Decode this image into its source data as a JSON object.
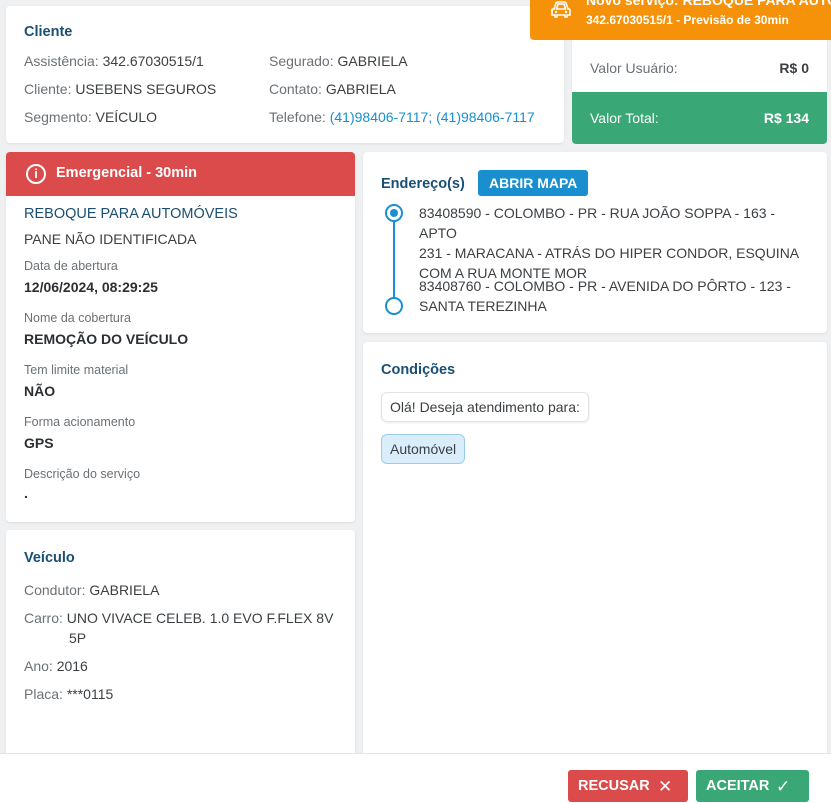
{
  "cliente": {
    "title": "Cliente",
    "assistencia_label": "Assistência:",
    "assistencia_value": "342.67030515/1",
    "cliente_label": "Cliente:",
    "cliente_value": "USEBENS SEGUROS",
    "segmento_label": "Segmento:",
    "segmento_value": "VEÍCULO",
    "segurado_label": "Segurado:",
    "segurado_value": "GABRIELA",
    "contato_label": "Contato:",
    "contato_value": "GABRIELA",
    "telefone_label": "Telefone:",
    "telefone_value": "(41)98406-7117; (41)98406-7117"
  },
  "toast": {
    "title": "Novo serviço: REBOQUE PARA AUTO",
    "subtitle": "342.67030515/1 - Previsão de 30min",
    "icon": "car-icon",
    "color": "#f5920a"
  },
  "valores": {
    "usuario_label": "Valor Usuário:",
    "usuario_value": "R$ 0",
    "total_label": "Valor Total:",
    "total_value": "R$ 134",
    "total_color": "#3aa876"
  },
  "servico": {
    "badge": "Emergencial - 30min",
    "badge_color": "#dc4b4b",
    "title": "REBOQUE PARA AUTOMÓVEIS",
    "subtitle": "PANE NÃO IDENTIFICADA",
    "fields": [
      {
        "label": "Data de abertura",
        "value": "12/06/2024, 08:29:25"
      },
      {
        "label": "Nome da cobertura",
        "value": "REMOÇÃO DO VEÍCULO"
      },
      {
        "label": "Tem limite material",
        "value": "NÃO"
      },
      {
        "label": "Forma acionamento",
        "value": "GPS"
      },
      {
        "label": "Descrição do serviço",
        "value": "."
      }
    ]
  },
  "endereco": {
    "title": "Endereço(s)",
    "map_button": "ABRIR MAPA",
    "origem_line1": "83408590 - COLOMBO - PR - RUA JOÃO SOPPA - 163 - APTO",
    "origem_line2": "231 - MARACANA - ATRÁS DO HIPER CONDOR, ESQUINA",
    "origem_line3": "COM A RUA MONTE MOR",
    "destino_line1": "83408760 - COLOMBO - PR - AVENIDA DO PÔRTO - 123 -",
    "destino_line2": "SANTA TEREZINHA"
  },
  "condicoes": {
    "title": "Condições",
    "question": "Olá! Deseja atendimento para:",
    "answer": "Automóvel"
  },
  "veiculo": {
    "title": "Veículo",
    "condutor_label": "Condutor:",
    "condutor_value": "GABRIELA",
    "carro_label": "Carro:",
    "carro_value_line1": "UNO VIVACE CELEB. 1.0 EVO F.FLEX 8V",
    "carro_value_line2": "5P",
    "ano_label": "Ano:",
    "ano_value": "2016",
    "placa_label": "Placa:",
    "placa_value": "***0115"
  },
  "actions": {
    "recusar": "RECUSAR",
    "aceitar": "ACEITAR"
  }
}
